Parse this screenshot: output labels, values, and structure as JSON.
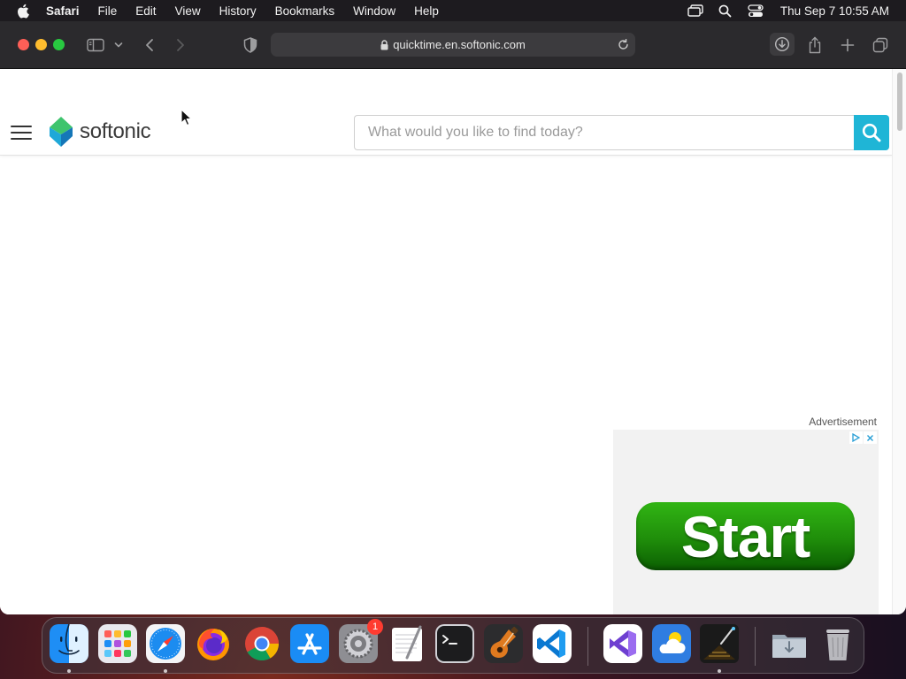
{
  "menubar": {
    "app_name": "Safari",
    "items": [
      "File",
      "Edit",
      "View",
      "History",
      "Bookmarks",
      "Window",
      "Help"
    ],
    "clock": "Thu Sep 7  10:55 AM",
    "status_icons": [
      "screen-mirroring-icon",
      "spotlight-search-icon",
      "control-center-icon"
    ]
  },
  "browser": {
    "url": "quicktime.en.softonic.com"
  },
  "site": {
    "logo_text": "softonic",
    "search_placeholder": "What would you like to find today?",
    "brand_color": "#1fb5d6"
  },
  "ad": {
    "label": "Advertisement",
    "button_text": "Start",
    "button_color": "#1f8d0a"
  },
  "dock": {
    "apps": [
      "Finder",
      "Launchpad",
      "Safari",
      "Firefox",
      "Google Chrome",
      "App Store",
      "System Settings",
      "TextEdit",
      "Terminal",
      "GarageBand",
      "Visual Studio Code",
      "Visual Studio",
      "Weather",
      "Pixelmator",
      "Downloads",
      "Trash"
    ],
    "settings_badge": "1"
  }
}
